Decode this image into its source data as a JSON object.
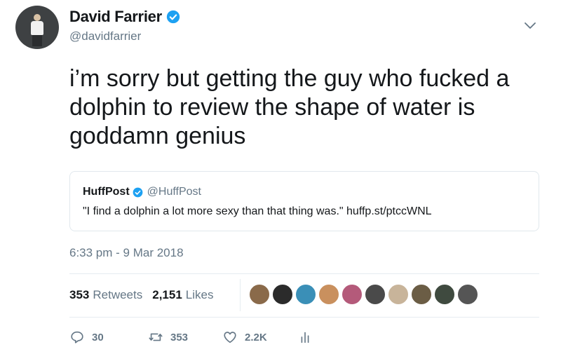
{
  "author": {
    "name": "David Farrier",
    "handle": "@davidfarrier"
  },
  "tweet": {
    "text": "i’m sorry but getting the guy who fucked a dolphin to review the shape of water is goddamn genius",
    "timestamp": "6:33 pm - 9 Mar 2018"
  },
  "quoted": {
    "name": "HuffPost",
    "handle": "@HuffPost",
    "text": "\"I find a dolphin a lot more sexy than that thing was.\" huffp.st/ptccWNL"
  },
  "stats": {
    "retweets_count": "353",
    "retweets_label": "Retweets",
    "likes_count": "2,151",
    "likes_label": "Likes"
  },
  "actions": {
    "reply_count": "30",
    "retweet_count": "353",
    "like_count": "2.2K"
  },
  "liker_avatar_colors": [
    "#8a6a4a",
    "#2b2b2b",
    "#3a8fb7",
    "#c9905e",
    "#b45a7a",
    "#4a4a4a",
    "#c8b49a",
    "#6b5d45",
    "#3f4a3f",
    "#555555"
  ],
  "colors": {
    "verified": "#1da1f2",
    "secondary_text": "#657786"
  },
  "icons": [
    "verified-badge-icon",
    "chevron-down-icon",
    "reply-icon",
    "retweet-icon",
    "like-icon",
    "analytics-icon"
  ]
}
